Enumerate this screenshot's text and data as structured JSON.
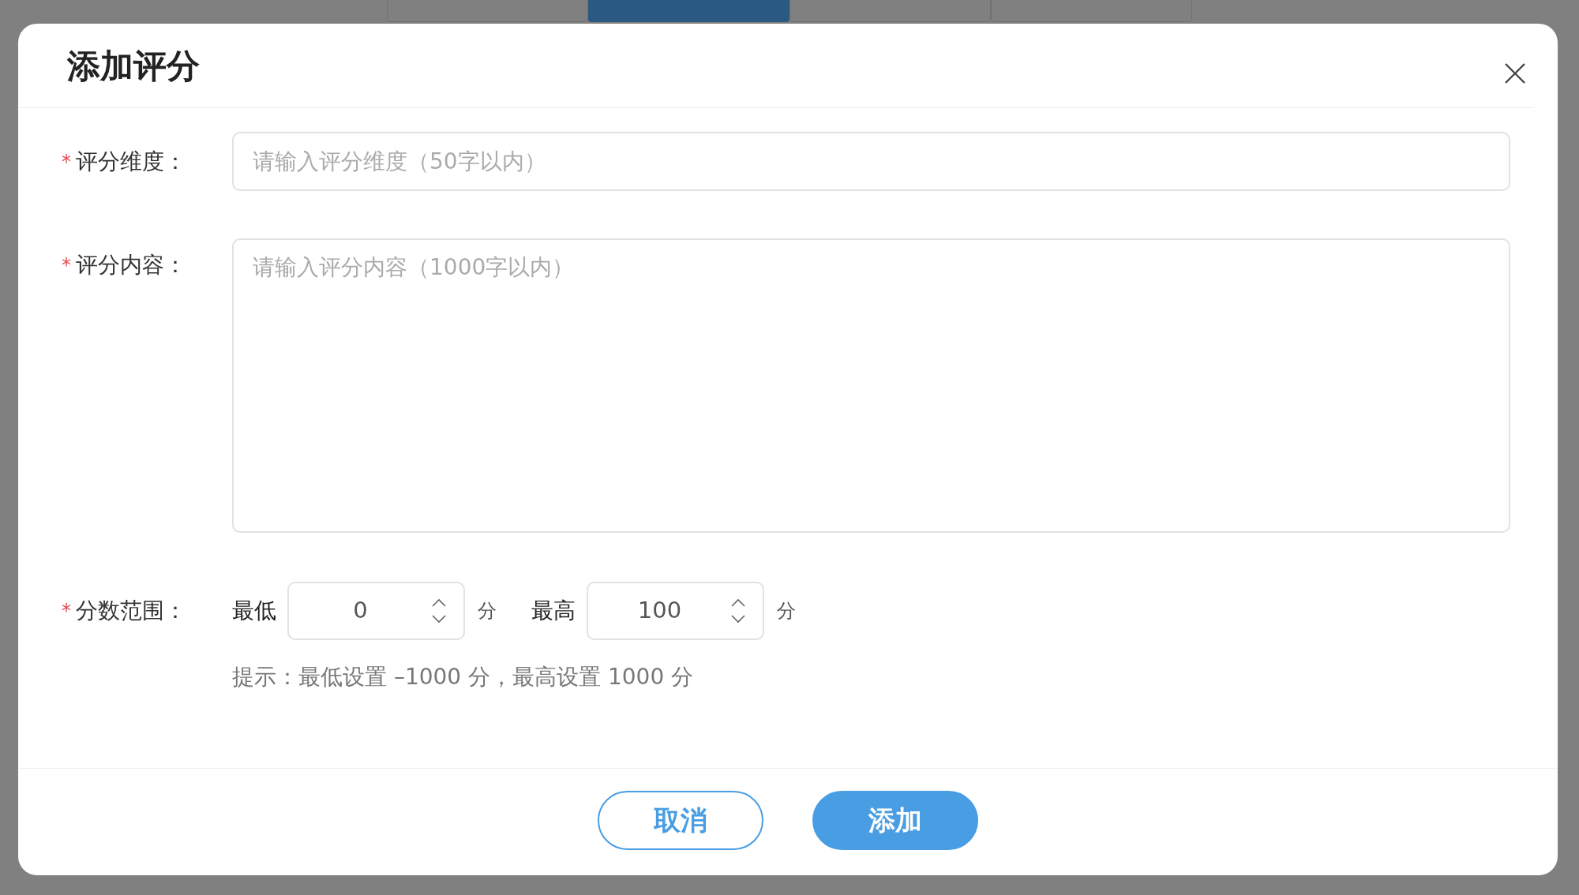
{
  "background": {
    "tabs": [
      {
        "selected": false
      },
      {
        "selected": true
      },
      {
        "selected": false
      },
      {
        "selected": false
      }
    ]
  },
  "dialog": {
    "title": "添加评分",
    "fields": [
      {
        "kind": "input",
        "label": "评分维度：",
        "required_mark": "*",
        "placeholder": "请输入评分维度（50字以内）"
      },
      {
        "kind": "textarea",
        "label": "评分内容：",
        "required_mark": "*",
        "placeholder": "请输入评分内容（1000字以内）"
      },
      {
        "kind": "range",
        "label": "分数范围：",
        "required_mark": "*",
        "min_label": "最低",
        "min_value": "0",
        "min_unit": "分",
        "max_label": "最高",
        "max_value": "100",
        "max_unit": "分"
      }
    ],
    "hint": "提示：最低设置 –1000 分，最高设置 1000 分",
    "buttons": [
      {
        "label": "取消",
        "kind": "secondary"
      },
      {
        "label": "添加",
        "kind": "primary"
      }
    ]
  }
}
